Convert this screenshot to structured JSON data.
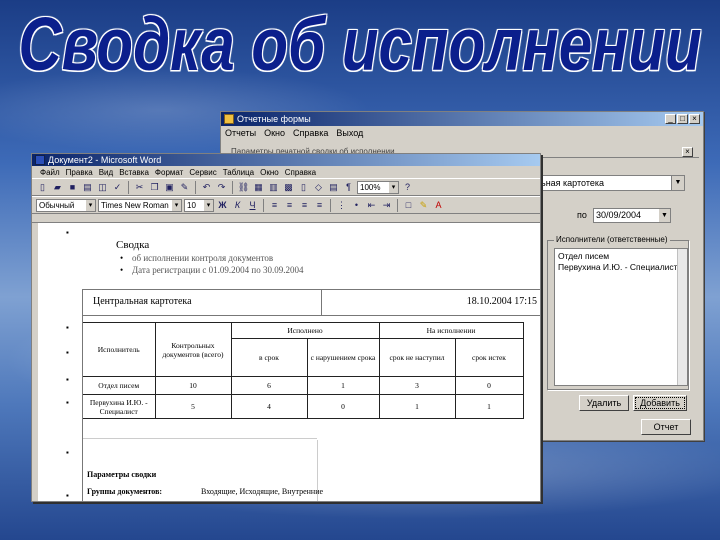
{
  "slide": {
    "title": "Сводка об исполнении"
  },
  "report_forms_window": {
    "title": "Отчетные формы",
    "menu": [
      "Отчеты",
      "Окно",
      "Справка",
      "Выход"
    ],
    "inner_title": "Параметры печатной сводки об исполнении",
    "card_combo": "ьная картотека",
    "date_label": "по",
    "date_value": "30/09/2004",
    "executors_group": {
      "title": "Исполнители (ответственные)",
      "items": [
        "Отдел писем",
        "Первухина И.Ю. - Специалист"
      ]
    },
    "buttons": {
      "delete": "Удалить",
      "add": "Добавить",
      "report": "Отчет"
    }
  },
  "word_window": {
    "title": "Документ2 - Microsoft Word",
    "menu": [
      "Файл",
      "Правка",
      "Вид",
      "Вставка",
      "Формат",
      "Сервис",
      "Таблица",
      "Окно",
      "Справка"
    ],
    "zoom": "100%",
    "style": "Обычный",
    "font": "Times New Roman",
    "font_size": "10",
    "document": {
      "heading": "Сводка",
      "bullets": [
        "об исполнении контроля документов",
        "Дата регистрации с 01.09.2004 по 30.09.2004"
      ],
      "card_name": "Центральная картотека",
      "timestamp": "18.10.2004 17:15",
      "table": {
        "col_executor": "Исполнитель",
        "col_controlled": "Контрольных документов (всего)",
        "group_done": "Исполнено",
        "group_in_progress": "На исполнении",
        "sub_on_time": "в срок",
        "sub_late": "с нарушением срока",
        "sub_not_due": "срок не наступил",
        "sub_overdue": "срок истек",
        "rows": [
          {
            "executor": "Отдел писем",
            "values": [
              "10",
              "6",
              "1",
              "3",
              "0"
            ]
          },
          {
            "executor": "Первухина И.Ю. - Специалист",
            "values": [
              "5",
              "4",
              "0",
              "1",
              "1"
            ]
          }
        ]
      },
      "params_title": "Параметры сводки",
      "doc_groups_label": "Группы документов:",
      "doc_groups_value": "Входящие, Исходящие, Внутренние"
    }
  }
}
